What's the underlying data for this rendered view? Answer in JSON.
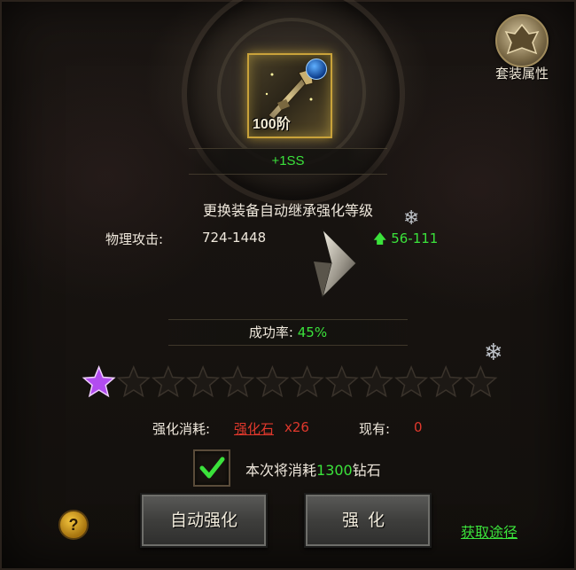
{
  "item": {
    "tier_label": "100阶",
    "grade": "+1SS",
    "gem_icon": "blue-orb-icon",
    "weapon_icon": "staff-weapon-icon"
  },
  "set_attributes": {
    "label": "套装属性",
    "icon": "set-emblem-icon"
  },
  "inherit_notice": "更换装备自动继承强化等级",
  "stat": {
    "name": "物理攻击:",
    "value": "724-1448",
    "gain": "56-111",
    "gain_icon": "arrow-up-icon"
  },
  "success_rate": {
    "label": "成功率:",
    "value": "45%"
  },
  "stars": {
    "total": 12,
    "filled": 1
  },
  "cost": {
    "label": "强化消耗:",
    "item_name": "强化石",
    "quantity": "x26",
    "owned_label": "现有:",
    "owned_value": "0"
  },
  "diamond_option": {
    "checked": true,
    "prefix": "本次将消耗",
    "amount": "1300",
    "suffix": "钻石"
  },
  "buttons": {
    "auto_enhance": "自动强化",
    "enhance": "强化"
  },
  "help_label": "?",
  "get_link": "获取途径",
  "colors": {
    "positive": "#3be23b",
    "negative": "#e0382c",
    "text": "#efe8dc",
    "gold_border": "#c9a23a"
  }
}
